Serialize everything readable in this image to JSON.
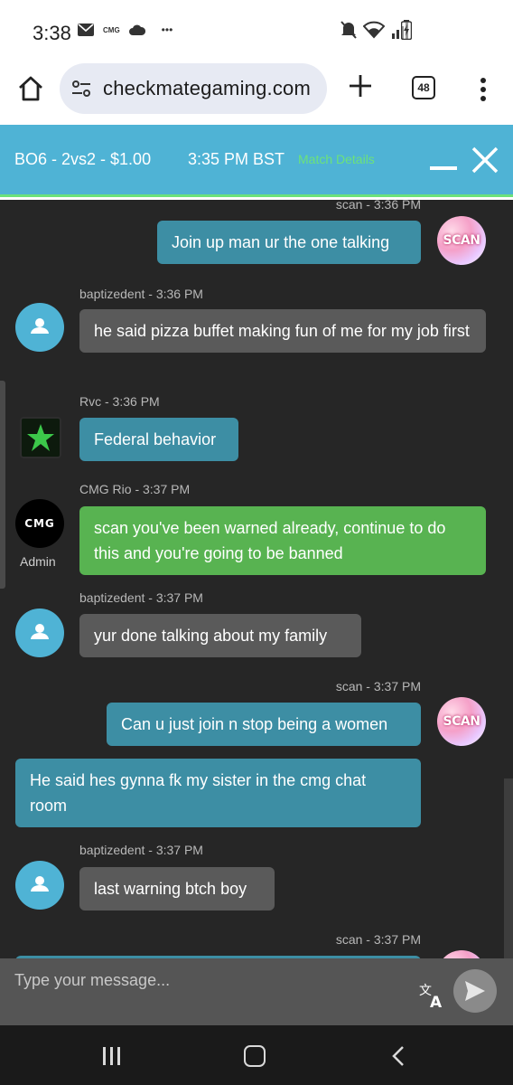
{
  "status": {
    "time": "3:38",
    "notif_label": "CMG",
    "more": "•••"
  },
  "browser": {
    "url": "checkmategaming.com",
    "tab_count": "48"
  },
  "header": {
    "match": "BO6 - 2vs2 - $1.00",
    "time": "3:35 PM BST",
    "details_link": "Match Details"
  },
  "messages": [
    {
      "author": "scan - 3:36 PM",
      "text": "Join up man ur the one talking"
    },
    {
      "author": "baptizedent - 3:36 PM",
      "text": "he said pizza buffet making fun of me for my job first"
    },
    {
      "author": "Rvc - 3:36 PM",
      "text": "Federal behavior"
    },
    {
      "author": "CMG Rio - 3:37 PM",
      "text": "scan you've been warned already, continue to do this and you're going to be banned",
      "badge": "Admin",
      "avatar_text": "CMG"
    },
    {
      "author": "baptizedent - 3:37 PM",
      "text": "yur done talking about my family"
    },
    {
      "author": "scan - 3:37 PM",
      "text": "Can u just join n stop being a women"
    },
    {
      "author": "",
      "text": "He said hes gynna fk my sister in the cmg chat room"
    },
    {
      "author": "baptizedent - 3:37 PM",
      "text": "last warning btch boy"
    },
    {
      "author": "scan - 3:37 PM",
      "text": ""
    }
  ],
  "scan_avatar_text": "SCAN",
  "input": {
    "placeholder": "Type your message..."
  },
  "colors": {
    "header_bg": "#4fb3d5",
    "accent_green": "#6ce27a",
    "bubble_blue": "#3d8ea4",
    "bubble_gray": "#5a5a5a",
    "bubble_admin": "#58b351",
    "chat_bg": "#262626"
  }
}
